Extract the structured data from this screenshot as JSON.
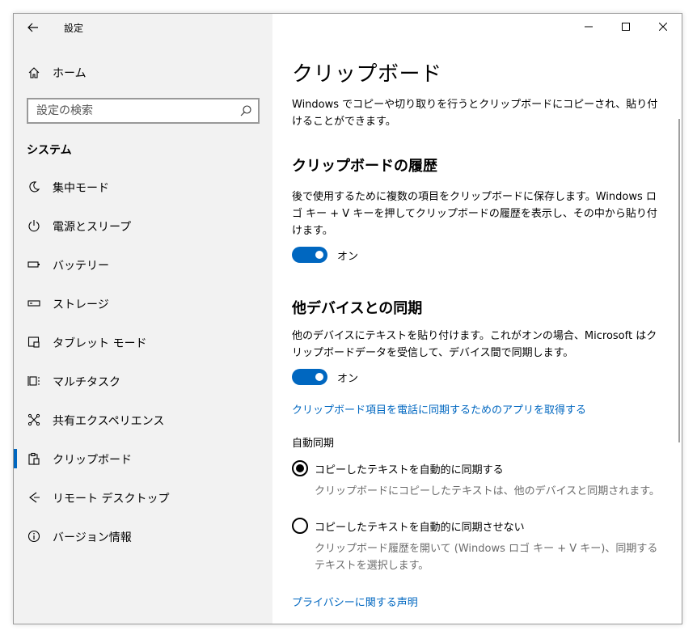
{
  "window": {
    "app_title": "設定"
  },
  "sidebar": {
    "home_label": "ホーム",
    "search_placeholder": "設定の検索",
    "section_heading": "システム",
    "items": [
      {
        "label": "集中モード",
        "icon": "moon-icon"
      },
      {
        "label": "電源とスリープ",
        "icon": "power-icon"
      },
      {
        "label": "バッテリー",
        "icon": "battery-icon"
      },
      {
        "label": "ストレージ",
        "icon": "storage-icon"
      },
      {
        "label": "タブレット モード",
        "icon": "tablet-mode-icon"
      },
      {
        "label": "マルチタスク",
        "icon": "multitask-icon"
      },
      {
        "label": "共有エクスペリエンス",
        "icon": "shared-experience-icon"
      },
      {
        "label": "クリップボード",
        "icon": "clipboard-icon",
        "active": true
      },
      {
        "label": "リモート デスクトップ",
        "icon": "remote-desktop-icon"
      },
      {
        "label": "バージョン情報",
        "icon": "info-icon"
      }
    ]
  },
  "main": {
    "title": "クリップボード",
    "intro": "Windows でコピーや切り取りを行うとクリップボードにコピーされ、貼り付けることができます。",
    "history": {
      "heading": "クリップボードの履歴",
      "description": "後で使用するために複数の項目をクリップボードに保存します。Windows ロゴ キー + V キーを押してクリップボードの履歴を表示し、その中から貼り付けます。",
      "toggle_label": "オン",
      "toggle_on": true
    },
    "sync": {
      "heading": "他デバイスとの同期",
      "description": "他のデバイスにテキストを貼り付けます。これがオンの場合、Microsoft はクリップボードデータを受信して、デバイス間で同期します。",
      "toggle_label": "オン",
      "toggle_on": true,
      "app_link": "クリップボード項目を電話に同期するためのアプリを取得する",
      "auto_sync_label": "自動同期",
      "option_auto": "コピーしたテキストを自動的に同期する",
      "option_auto_desc": "クリップボードにコピーしたテキストは、他のデバイスと同期されます。",
      "option_manual": "コピーしたテキストを自動的に同期させない",
      "option_manual_desc": "クリップボード履歴を開いて (Windows ロゴ キー + V キー)、同期するテキストを選択します。"
    },
    "privacy_link": "プライバシーに関する声明"
  },
  "colors": {
    "accent": "#0067c0",
    "sidebar_bg": "#f2f2f2",
    "secondary_text": "#6b6b6b"
  }
}
